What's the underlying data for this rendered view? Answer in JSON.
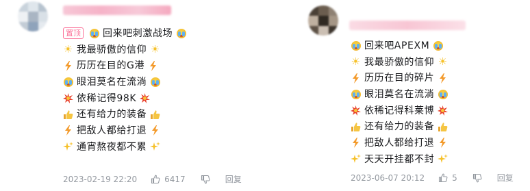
{
  "comments": [
    {
      "pinned_label": "置顶",
      "lines": [
        {
          "pre": "cry",
          "text": "回来吧刺激战场",
          "post": "cry"
        },
        {
          "pre": "sun",
          "text": "我最骄傲的信仰",
          "post": "sun"
        },
        {
          "pre": "bolt",
          "text": "历历在目的G港",
          "post": "bolt"
        },
        {
          "pre": "cry",
          "text": "眼泪莫名在流淌",
          "post": "cry"
        },
        {
          "pre": "boom",
          "text": "依稀记得98K",
          "post": "boom"
        },
        {
          "pre": "thumb",
          "text": "还有给力的装备",
          "post": "thumb"
        },
        {
          "pre": "bolt",
          "text": "把敌人都给打退",
          "post": "bolt"
        },
        {
          "pre": "spark",
          "text": "通宵熬夜都不累",
          "post": "spark"
        }
      ],
      "date": "2023-02-19 22:20",
      "likes": "6417",
      "reply_label": "回复"
    },
    {
      "lines": [
        {
          "pre": "cry",
          "text": "回来吧APEXM",
          "post": "cry"
        },
        {
          "pre": "sun",
          "text": "我最骄傲的信仰",
          "post": "sun"
        },
        {
          "pre": "bolt",
          "text": "历历在目的碎片",
          "post": "bolt"
        },
        {
          "pre": "cry",
          "text": "眼泪莫名在流淌",
          "post": "cry"
        },
        {
          "pre": "boom",
          "text": "依稀记得科莱博",
          "post": "boom"
        },
        {
          "pre": "thumb",
          "text": "还有给力的装备",
          "post": "thumb"
        },
        {
          "pre": "bolt",
          "text": "把敌人都给打退",
          "post": "bolt"
        },
        {
          "pre": "spark",
          "text": "天天开挂都不封",
          "post": "spark"
        }
      ],
      "date": "2023-06-07 20:12",
      "likes": "5",
      "reply_label": "回复"
    }
  ],
  "icons": {
    "cry": "crying-face-icon",
    "sun": "sun-icon",
    "bolt": "lightning-icon",
    "boom": "collision-icon",
    "thumb": "thumbs-up-icon",
    "spark": "sparkles-icon",
    "like": "thumbs-up-outline-icon",
    "dislike": "thumbs-down-outline-icon"
  },
  "colors": {
    "pin": "#fb7299",
    "meta": "#9499a0",
    "text": "#18191c"
  }
}
